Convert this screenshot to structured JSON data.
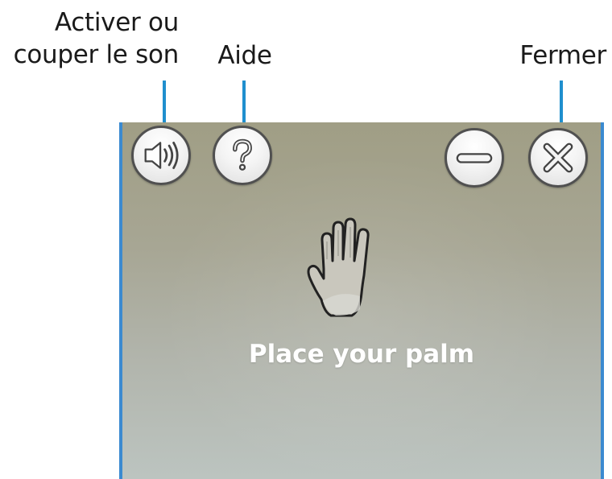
{
  "callouts": {
    "sound": {
      "line1": "Activer ou",
      "line2": "couper le son"
    },
    "help": {
      "label": "Aide"
    },
    "close": {
      "label": "Fermer"
    }
  },
  "window": {
    "buttons": [
      {
        "name": "sound-button",
        "icon": "speaker-icon"
      },
      {
        "name": "help-button",
        "icon": "question-icon"
      },
      {
        "name": "minimize-button",
        "icon": "minus-icon"
      },
      {
        "name": "close-button",
        "icon": "close-x-icon"
      }
    ],
    "illustration": "hand-palm-icon",
    "instruction": "Place your palm"
  },
  "colors": {
    "callout_accent": "#1f8fce",
    "panel_top": "#a09e85",
    "panel_bottom": "#bcc4c0",
    "button_border": "#505050",
    "instruction_text": "#ffffff"
  }
}
